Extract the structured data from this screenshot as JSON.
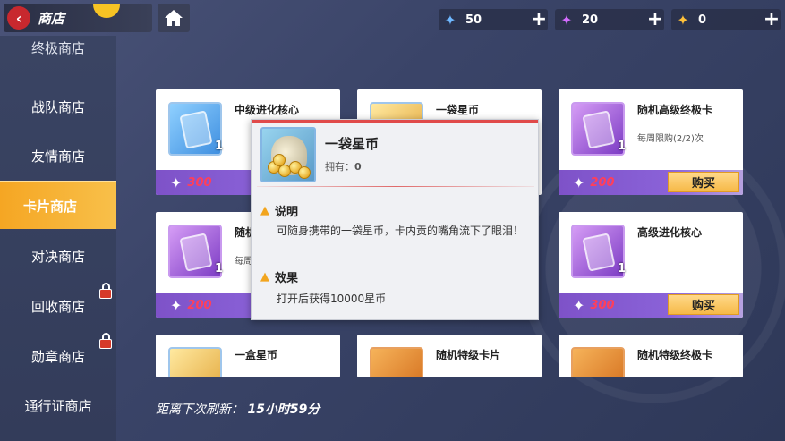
{
  "header": {
    "title": "商店"
  },
  "currencies": [
    {
      "icon": "blue-crystal-icon",
      "value": "50",
      "color": "#6fb8ff"
    },
    {
      "icon": "purple-crystal-icon",
      "value": "20",
      "color": "#d46cff"
    },
    {
      "icon": "gold-crystal-icon",
      "value": "0",
      "color": "#ffc13a"
    }
  ],
  "sidebar": {
    "items": [
      {
        "label": "终极商店"
      },
      {
        "label": "战队商店"
      },
      {
        "label": "友情商店"
      },
      {
        "label": "卡片商店"
      },
      {
        "label": "对决商店"
      },
      {
        "label": "回收商店"
      },
      {
        "label": "勋章商店"
      },
      {
        "label": "通行证商店"
      }
    ]
  },
  "cards": [
    {
      "name": "中级进化核心",
      "qty": "1",
      "price": "300",
      "limit": "",
      "buy": ""
    },
    {
      "name": "一袋星币",
      "qty": "",
      "price": "",
      "limit": "",
      "buy": ""
    },
    {
      "name": "随机高级终极卡",
      "qty": "1",
      "price": "200",
      "limit": "每周限购(2/2)次",
      "buy": "购买"
    },
    {
      "name": "随机",
      "qty": "1",
      "price": "200",
      "limit": "每周",
      "buy": ""
    },
    {
      "name": "高级进化核心",
      "qty": "1",
      "price": "300",
      "limit": "",
      "buy": "购买"
    },
    {
      "name": "一盒星币",
      "qty": "",
      "price": "",
      "limit": "",
      "buy": ""
    },
    {
      "name": "随机特级卡片",
      "qty": "",
      "price": "",
      "limit": "",
      "buy": ""
    },
    {
      "name": "随机特级终极卡",
      "qty": "",
      "price": "",
      "limit": "",
      "buy": ""
    }
  ],
  "popup": {
    "title": "一袋星币",
    "owned_label": "拥有：",
    "owned_value": "0",
    "desc_heading": "说明",
    "desc_text": "可随身携带的一袋星币，卡内贡的嘴角流下了眼泪！",
    "effect_heading": "效果",
    "effect_text": "打开后获得10000星币"
  },
  "refresh": {
    "label": "距离下次刷新：",
    "time": "15小时59分"
  }
}
